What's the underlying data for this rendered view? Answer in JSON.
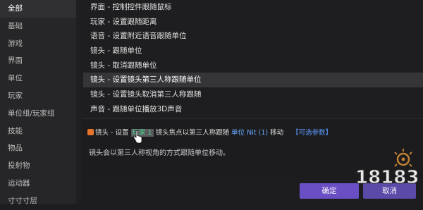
{
  "sidebar": {
    "items": [
      {
        "label": "全部",
        "active": true
      },
      {
        "label": "基础"
      },
      {
        "label": "游戏"
      },
      {
        "label": "界面"
      },
      {
        "label": "单位"
      },
      {
        "label": "玩家"
      },
      {
        "label": "单位组/玩家组"
      },
      {
        "label": "技能"
      },
      {
        "label": "物品"
      },
      {
        "label": "投射物"
      },
      {
        "label": "运动器"
      },
      {
        "label": "寸寸寸层"
      }
    ]
  },
  "actions": {
    "items": [
      {
        "label": "界面 - 控制控件跟随鼠标"
      },
      {
        "label": "玩家 - 设置跟随距离"
      },
      {
        "label": "语音 - 设置附近语音跟随单位"
      },
      {
        "label": "镜头 - 跟随单位"
      },
      {
        "label": "镜头 - 取消跟随单位"
      },
      {
        "label": "镜头 - 设置镜头第三人称跟随单位",
        "selected": true
      },
      {
        "label": "镜头 - 设置镜头取消第三人称跟随"
      },
      {
        "label": "声音 - 跟随单位播放3D声音"
      }
    ]
  },
  "detail": {
    "prefix": "镜头 - 设置 ",
    "param_player": "玩家 1",
    "middle": " 镜头焦点以第三人称跟随 ",
    "param_unit": "单位 Nit (1)",
    "suffix": " 移动",
    "optional": "【可选参数】",
    "description": "镜头会以第三人称视角的方式跟随单位移动。"
  },
  "buttons": {
    "ok": "确定",
    "cancel": "取消"
  },
  "watermark": {
    "text": "18183"
  },
  "colors": {
    "accent": "#6a4fc4",
    "param_green": "#3fc47d",
    "param_blue": "#66a7ff",
    "icon_orange": "#e7742a"
  }
}
